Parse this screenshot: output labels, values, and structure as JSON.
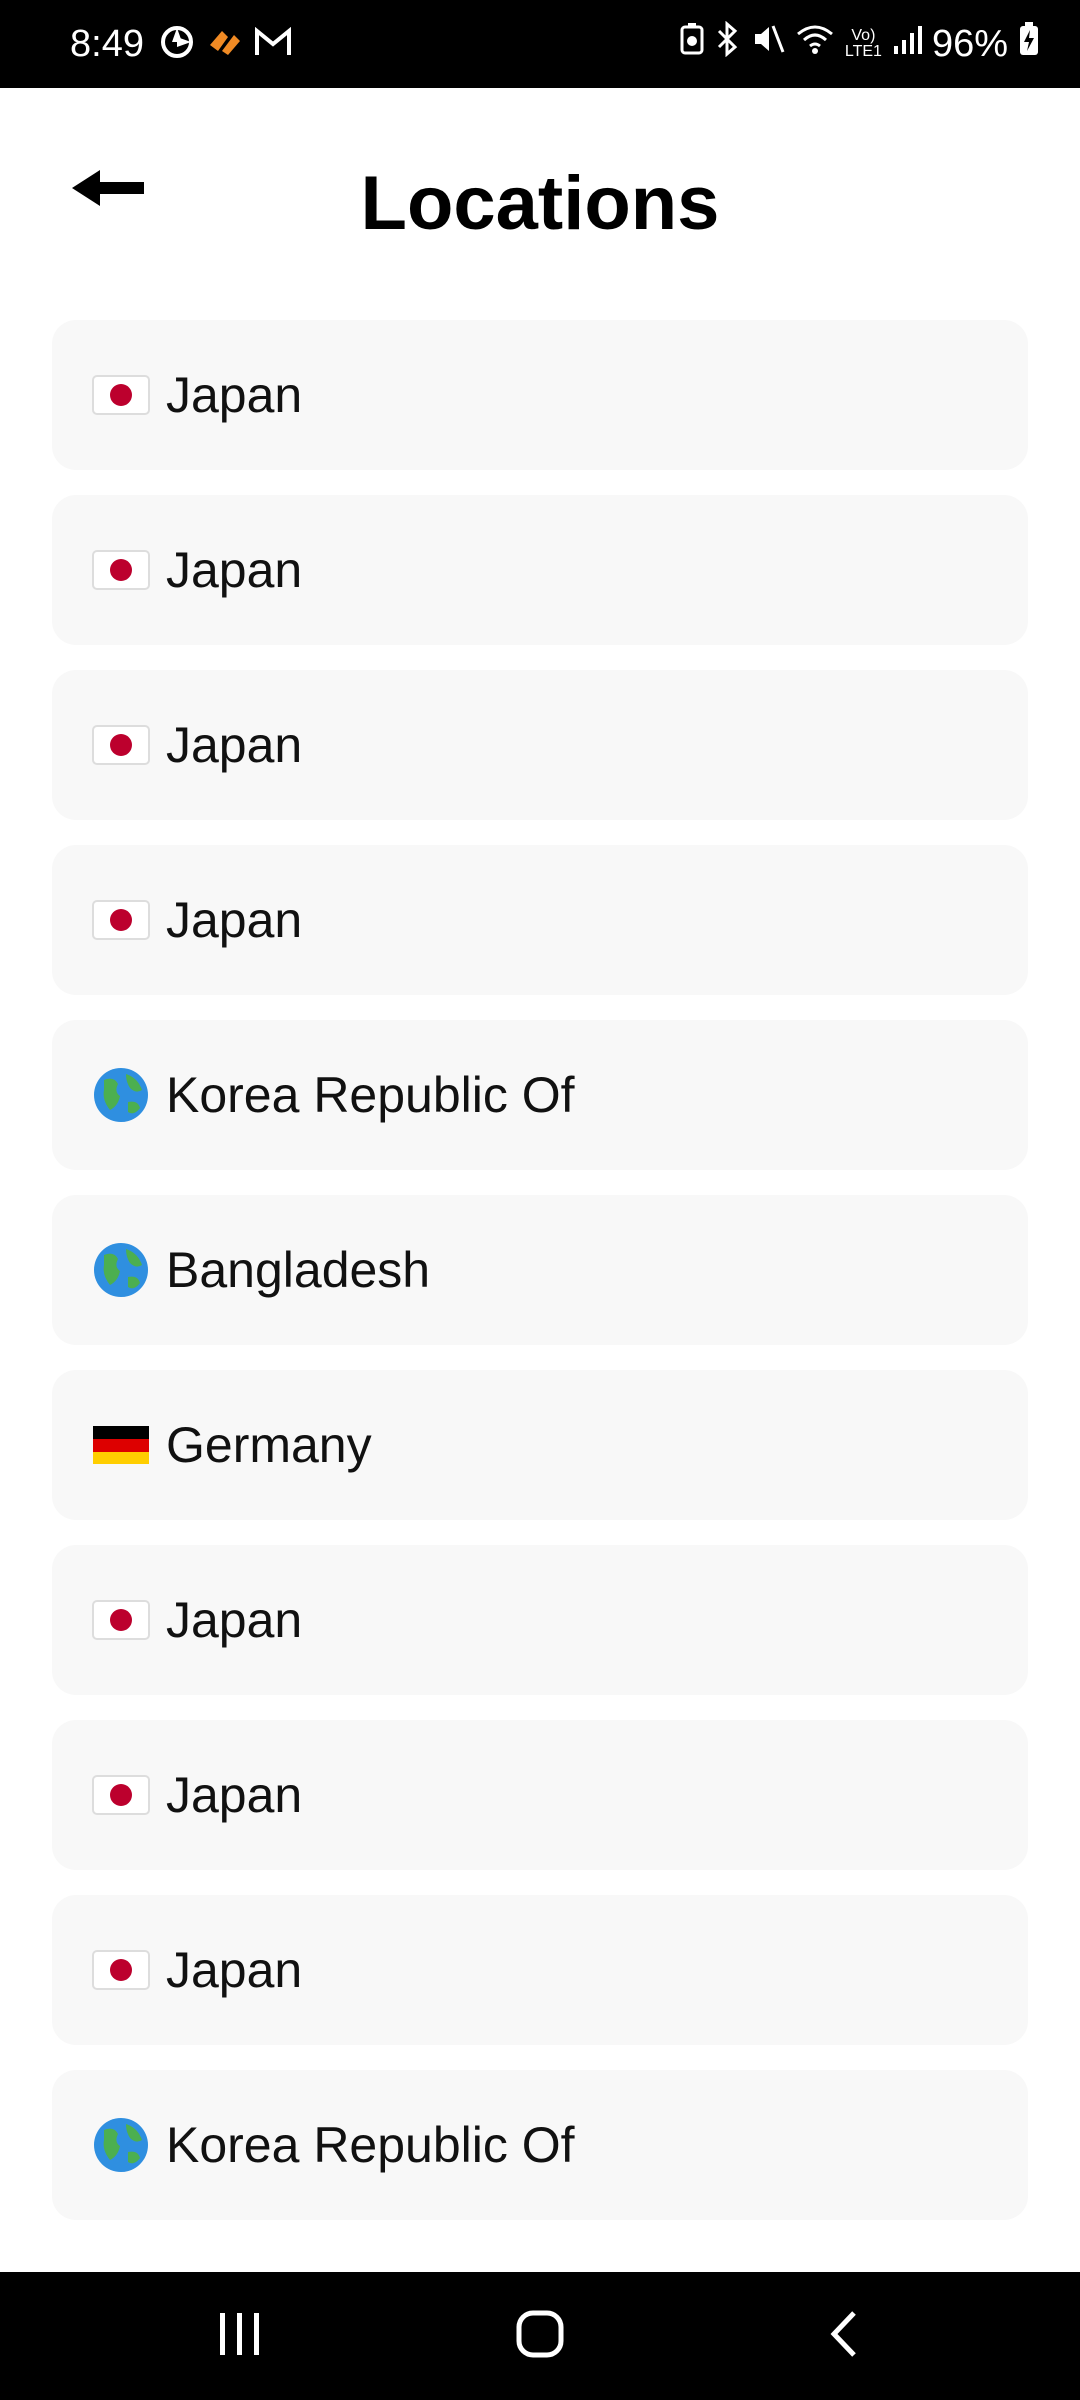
{
  "status_bar": {
    "time": "8:49",
    "battery": "96%",
    "network": "LTE1"
  },
  "header": {
    "title": "Locations",
    "back_icon": "arrow-left-icon"
  },
  "locations": [
    {
      "label": "Japan",
      "flag": "japan-flag-icon"
    },
    {
      "label": "Japan",
      "flag": "japan-flag-icon"
    },
    {
      "label": "Japan",
      "flag": "japan-flag-icon"
    },
    {
      "label": "Japan",
      "flag": "japan-flag-icon"
    },
    {
      "label": "Korea Republic Of",
      "flag": "globe-icon"
    },
    {
      "label": "Bangladesh",
      "flag": "globe-icon"
    },
    {
      "label": "Germany",
      "flag": "germany-flag-icon"
    },
    {
      "label": "Japan",
      "flag": "japan-flag-icon"
    },
    {
      "label": "Japan",
      "flag": "japan-flag-icon"
    },
    {
      "label": "Japan",
      "flag": "japan-flag-icon"
    },
    {
      "label": "Korea Republic Of",
      "flag": "globe-icon"
    }
  ],
  "colors": {
    "row_background": "#f8f8f8",
    "japan_red": "#bc002d",
    "germany_black": "#000000",
    "germany_red": "#dd0000",
    "germany_gold": "#ffce00",
    "globe_blue": "#2f8fe0",
    "globe_green": "#4caf50"
  }
}
